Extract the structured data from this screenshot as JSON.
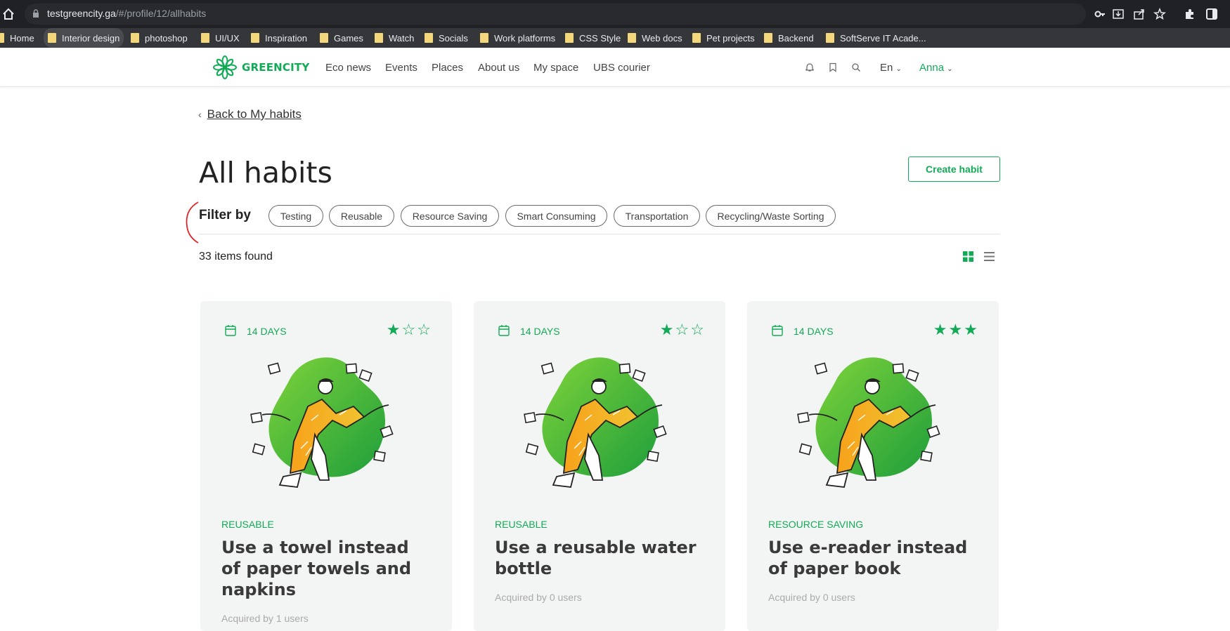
{
  "browser": {
    "url_host": "testgreencity.ga",
    "url_path": "/#/profile/12/allhabits",
    "bookmarks": [
      "Home",
      "Interior design",
      "photoshop",
      "UI/UX",
      "Inspiration",
      "Games",
      "Watch",
      "Socials",
      "Work platforms",
      "CSS Style",
      "Web docs",
      "Pet projects",
      "Backend",
      "SoftServe IT Acade..."
    ]
  },
  "header": {
    "logo_text": "GREENCITY",
    "nav": [
      "Eco news",
      "Events",
      "Places",
      "About us",
      "My space",
      "UBS courier"
    ],
    "lang": "En",
    "user": "Anna"
  },
  "page": {
    "back_link": "Back to My habits",
    "title": "All habits",
    "create_button": "Create habit",
    "filter_label": "Filter by",
    "filters": [
      "Testing",
      "Reusable",
      "Resource Saving",
      "Smart Consuming",
      "Transportation",
      "Recycling/Waste Sorting"
    ],
    "items_found": "33 items found"
  },
  "cards": [
    {
      "days": "14 DAYS",
      "rating": 1,
      "tag": "REUSABLE",
      "title": "Use a towel instead of paper towels and napkins",
      "acquired": "Acquired by 1 users"
    },
    {
      "days": "14 DAYS",
      "rating": 1,
      "tag": "REUSABLE",
      "title": "Use a reusable water bottle",
      "acquired": "Acquired by 0 users"
    },
    {
      "days": "14 DAYS",
      "rating": 3,
      "tag": "RESOURCE SAVING",
      "title": "Use e-reader instead of paper book",
      "acquired": "Acquired by 0 users"
    }
  ],
  "colors": {
    "accent": "#13aa57",
    "card_bg": "#f3f4f4"
  },
  "icons": [
    "home-icon",
    "lock-icon",
    "key-icon",
    "install-icon",
    "share-icon",
    "star-icon",
    "extensions-icon",
    "sidebar-icon",
    "bell-icon",
    "bookmark-icon",
    "search-icon",
    "chevron-down-icon",
    "grid-view-icon",
    "list-view-icon",
    "calendar-icon"
  ]
}
